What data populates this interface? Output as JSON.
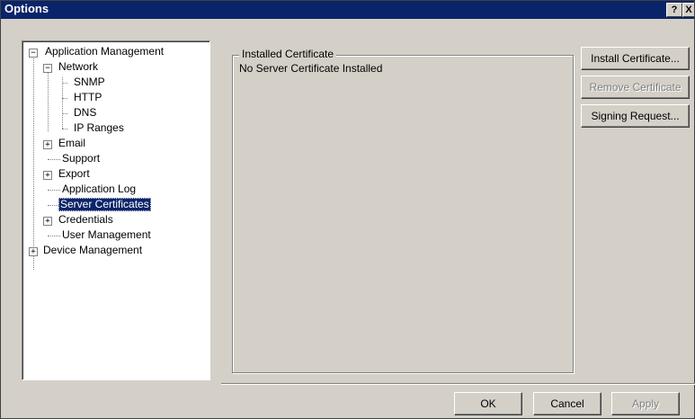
{
  "window": {
    "title": "Options",
    "help_glyph": "?",
    "close_glyph": "X"
  },
  "tree": {
    "nodes": [
      {
        "label": "Application Management",
        "expander": "−"
      },
      {
        "label": "Network",
        "expander": "−"
      },
      {
        "label": "SNMP"
      },
      {
        "label": "HTTP"
      },
      {
        "label": "DNS"
      },
      {
        "label": "IP Ranges"
      },
      {
        "label": "Email",
        "expander": "+"
      },
      {
        "label": "Support"
      },
      {
        "label": "Export",
        "expander": "+"
      },
      {
        "label": "Application Log"
      },
      {
        "label": "Server Certificates",
        "selected": true
      },
      {
        "label": "Credentials",
        "expander": "+"
      },
      {
        "label": "User Management"
      },
      {
        "label": "Device Management",
        "expander": "+"
      }
    ]
  },
  "certificate_panel": {
    "group_title": "Installed Certificate",
    "status_text": "No Server Certificate Installed"
  },
  "side_buttons": {
    "install": "Install Certificate...",
    "remove": "Remove Certificate",
    "signing": "Signing Request..."
  },
  "footer_buttons": {
    "ok": "OK",
    "cancel": "Cancel",
    "apply": "Apply"
  },
  "colors": {
    "titlebar": "#0a246a",
    "face": "#d4d0c8",
    "selection": "#0a246a"
  }
}
